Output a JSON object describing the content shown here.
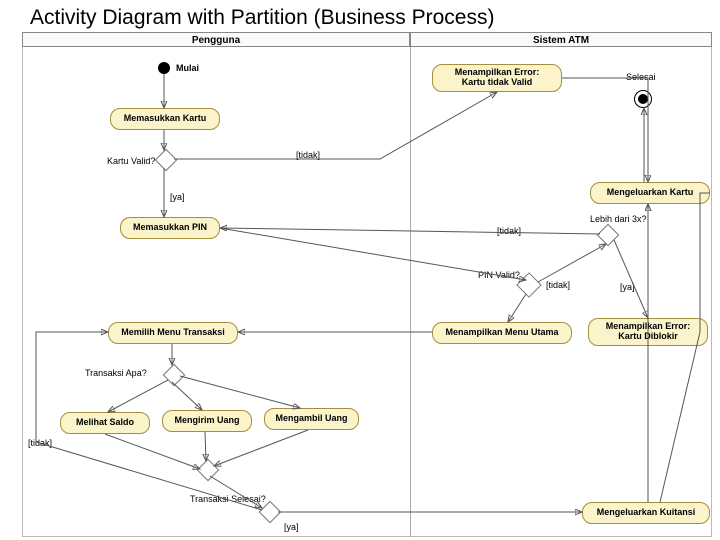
{
  "title": "Activity Diagram with Partition (Business Process)",
  "lanes": {
    "left": "Pengguna",
    "right": "Sistem ATM"
  },
  "nodes": {
    "mulai": "Mulai",
    "masukKartu": "Memasukkan Kartu",
    "kartuValid": "Kartu Valid?",
    "tidak1": "[tidak]",
    "ya1": "[ya]",
    "masukPIN": "Memasukkan PIN",
    "errKartu": "Menampilkan Error:\nKartu tidak Valid",
    "selesai": "Selesai",
    "keluarKartu": "Mengeluarkan Kartu",
    "lebih3x": "Lebih dari 3x?",
    "tidak2": "[tidak]",
    "pinValid": "PIN Valid?",
    "tidak3": "[tidak]",
    "ya3": "[ya]",
    "menuUtama": "Menampilkan Menu Utama",
    "errBlokir": "Menampilkan Error:\nKartu Diblokir",
    "pilihMenu": "Memilih Menu Transaksi",
    "transApa": "Transaksi Apa?",
    "saldo": "Melihat Saldo",
    "kirim": "Mengirim Uang",
    "ambil": "Mengambil Uang",
    "tidak4": "[tidak]",
    "transSelesai": "Transaksi Selesai?",
    "ya4": "[ya]",
    "kuitansi": "Mengeluarkan Kuitansi"
  }
}
